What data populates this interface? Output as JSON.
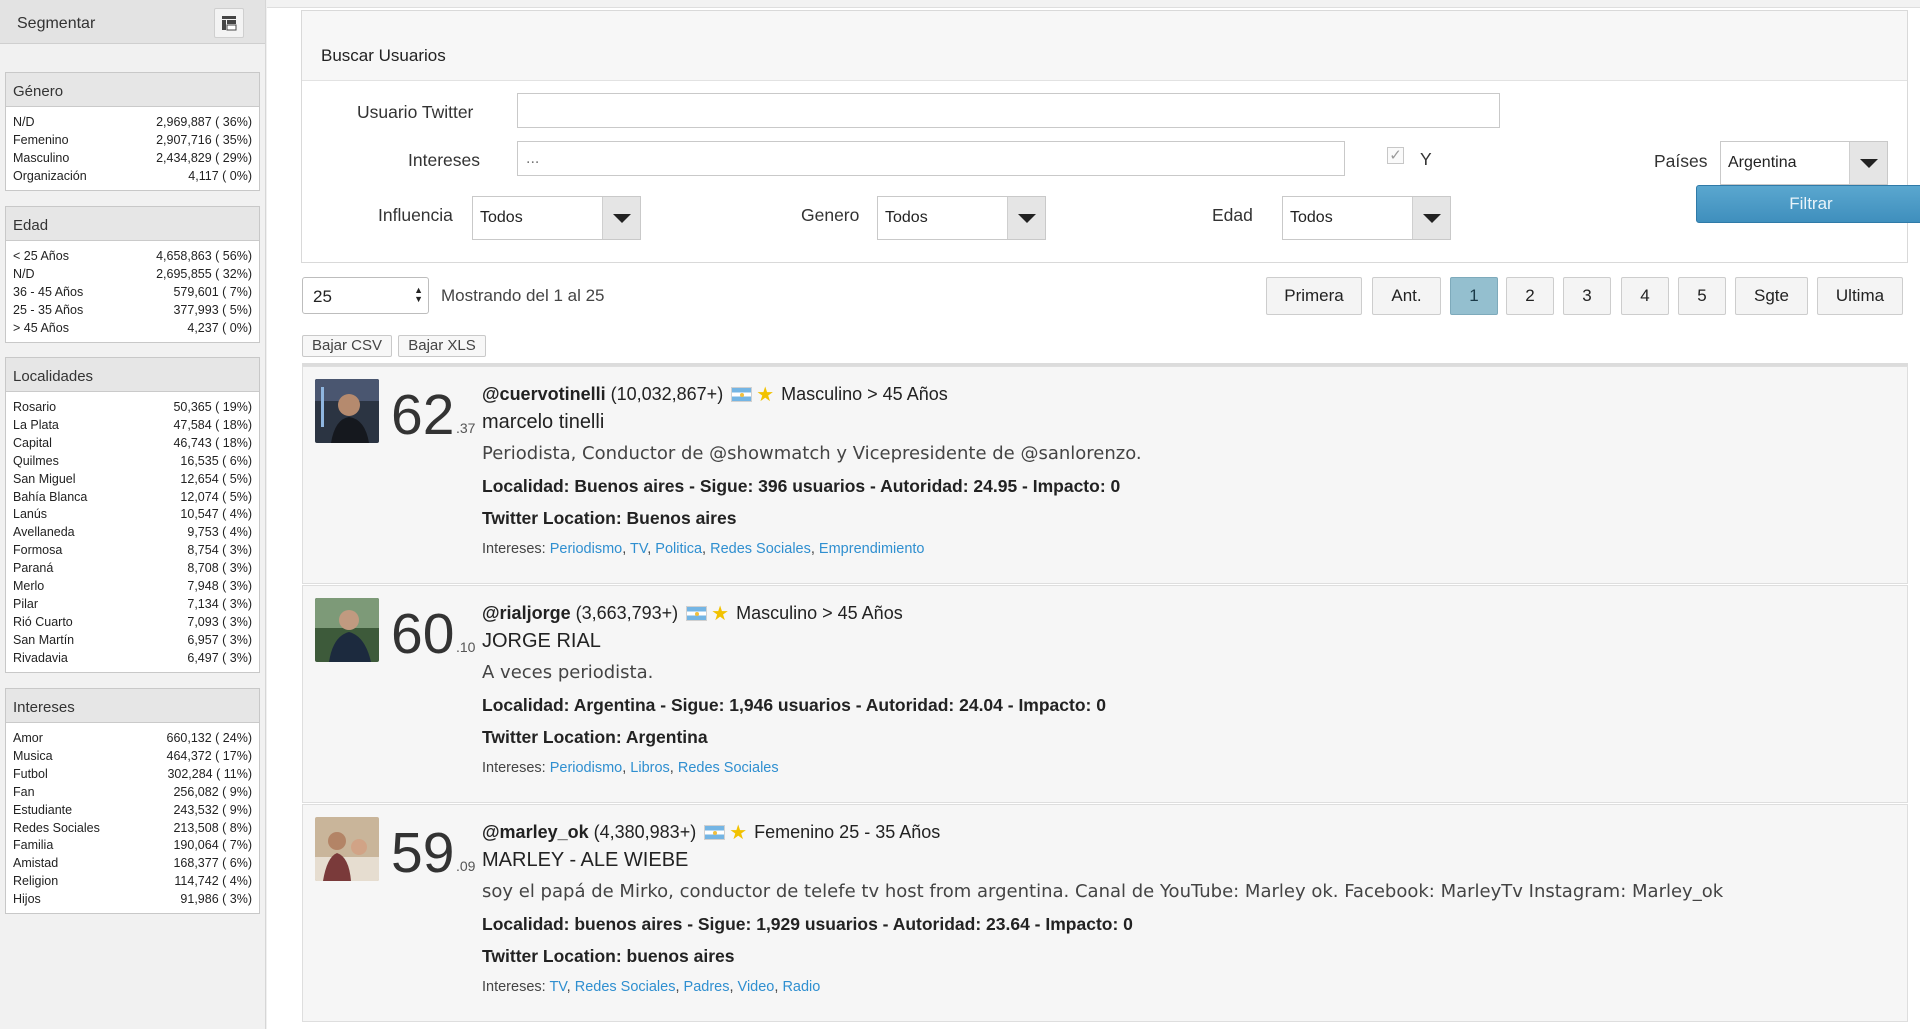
{
  "sidebar": {
    "title": "Segmentar",
    "panels": [
      {
        "title": "Género",
        "rows": [
          {
            "label": "N/D",
            "value": "2,969,887 ( 36%)"
          },
          {
            "label": "Femenino",
            "value": "2,907,716 ( 35%)"
          },
          {
            "label": "Masculino",
            "value": "2,434,829 ( 29%)"
          },
          {
            "label": "Organización",
            "value": "4,117 ( 0%)"
          }
        ]
      },
      {
        "title": "Edad",
        "rows": [
          {
            "label": "< 25 Años",
            "value": "4,658,863 ( 56%)"
          },
          {
            "label": "N/D",
            "value": "2,695,855 ( 32%)"
          },
          {
            "label": "36 - 45 Años",
            "value": "579,601 ( 7%)"
          },
          {
            "label": "25 - 35 Años",
            "value": "377,993 ( 5%)"
          },
          {
            "label": "> 45 Años",
            "value": "4,237 ( 0%)"
          }
        ]
      },
      {
        "title": "Localidades",
        "rows": [
          {
            "label": "Rosario",
            "value": "50,365 ( 19%)"
          },
          {
            "label": "La Plata",
            "value": "47,584 ( 18%)"
          },
          {
            "label": "Capital",
            "value": "46,743 ( 18%)"
          },
          {
            "label": "Quilmes",
            "value": "16,535 ( 6%)"
          },
          {
            "label": "San Miguel",
            "value": "12,654 ( 5%)"
          },
          {
            "label": "Bahía Blanca",
            "value": "12,074 ( 5%)"
          },
          {
            "label": "Lanús",
            "value": "10,547 ( 4%)"
          },
          {
            "label": "Avellaneda",
            "value": "9,753 ( 4%)"
          },
          {
            "label": "Formosa",
            "value": "8,754 ( 3%)"
          },
          {
            "label": "Paraná",
            "value": "8,708 ( 3%)"
          },
          {
            "label": "Merlo",
            "value": "7,948 ( 3%)"
          },
          {
            "label": "Pilar",
            "value": "7,134 ( 3%)"
          },
          {
            "label": "Rió Cuarto",
            "value": "7,093 ( 3%)"
          },
          {
            "label": "San Martín",
            "value": "6,957 ( 3%)"
          },
          {
            "label": "Rivadavia",
            "value": "6,497 ( 3%)"
          }
        ]
      },
      {
        "title": "Intereses",
        "rows": [
          {
            "label": "Amor",
            "value": "660,132 ( 24%)"
          },
          {
            "label": "Musica",
            "value": "464,372 ( 17%)"
          },
          {
            "label": "Futbol",
            "value": "302,284 ( 11%)"
          },
          {
            "label": "Fan",
            "value": "256,082 ( 9%)"
          },
          {
            "label": "Estudiante",
            "value": "243,532 ( 9%)"
          },
          {
            "label": "Redes Sociales",
            "value": "213,508 ( 8%)"
          },
          {
            "label": "Familia",
            "value": "190,064 ( 7%)"
          },
          {
            "label": "Amistad",
            "value": "168,377 ( 6%)"
          },
          {
            "label": "Religion",
            "value": "114,742 ( 4%)"
          },
          {
            "label": "Hijos",
            "value": "91,986 ( 3%)"
          }
        ]
      }
    ]
  },
  "search": {
    "title": "Buscar Usuarios",
    "usuario_label": "Usuario Twitter",
    "usuario_value": "",
    "intereses_label": "Intereses",
    "intereses_placeholder": "...",
    "y_label": "Y",
    "y_checked": true,
    "paises_label": "Países",
    "paises_value": "Argentina",
    "influencia_label": "Influencia",
    "influencia_value": "Todos",
    "genero_label": "Genero",
    "genero_value": "Todos",
    "edad_label": "Edad",
    "edad_value": "Todos",
    "filter_button": "Filtrar"
  },
  "pagination": {
    "page_size": "25",
    "showing": "Mostrando del 1 al 25",
    "first": "Primera",
    "prev": "Ant.",
    "pages": [
      "1",
      "2",
      "3",
      "4",
      "5"
    ],
    "current_page": "1",
    "next": "Sgte",
    "last": "Ultima"
  },
  "downloads": {
    "csv": "Bajar CSV",
    "xls": "Bajar XLS"
  },
  "results": [
    {
      "score_int": "62",
      "score_dec": ".37",
      "handle": "@cuervotinelli",
      "followers": "(10,032,867+)",
      "demographic": "Masculino > 45 Años",
      "name": "marcelo tinelli",
      "bio": "Periodista, Conductor de @showmatch y Vicepresidente de @sanlorenzo.",
      "metrics": "Localidad: Buenos aires - Sigue: 396 usuarios - Autoridad: 24.95 - Impacto: 0",
      "twitter_location": "Twitter Location: Buenos aires",
      "interests_label": "Intereses:",
      "interests": [
        "Periodismo",
        "TV",
        "Politica",
        "Redes Sociales",
        "Emprendimiento"
      ]
    },
    {
      "score_int": "60",
      "score_dec": ".10",
      "handle": "@rialjorge",
      "followers": "(3,663,793+)",
      "demographic": "Masculino > 45 Años",
      "name": "JORGE RIAL",
      "bio": "A veces periodista.",
      "metrics": "Localidad: Argentina - Sigue: 1,946 usuarios - Autoridad: 24.04 - Impacto: 0",
      "twitter_location": "Twitter Location: Argentina",
      "interests_label": "Intereses:",
      "interests": [
        "Periodismo",
        "Libros",
        "Redes Sociales"
      ]
    },
    {
      "score_int": "59",
      "score_dec": ".09",
      "handle": "@marley_ok",
      "followers": "(4,380,983+)",
      "demographic": "Femenino 25 - 35 Años",
      "name": "MARLEY - ALE WIEBE",
      "bio": "soy el papá de Mirko, conductor de telefe tv host from argentina. Canal de YouTube: Marley ok. Facebook: MarleyTv Instagram: Marley_ok",
      "metrics": "Localidad: buenos aires - Sigue: 1,929 usuarios - Autoridad: 23.64 - Impacto: 0",
      "twitter_location": "Twitter Location: buenos aires",
      "interests_label": "Intereses:",
      "interests": [
        "TV",
        "Redes Sociales",
        "Padres",
        "Video",
        "Radio"
      ]
    }
  ],
  "colors": {
    "link": "#2f8fd0",
    "filter_button": "#4a9bc7",
    "active_page": "#94bfcf",
    "star": "#f2c200"
  }
}
